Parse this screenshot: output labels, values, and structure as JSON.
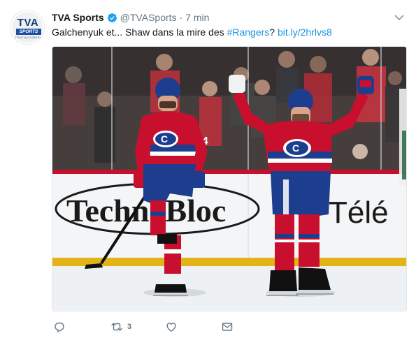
{
  "author": {
    "display_name": "TVA Sports",
    "handle": "@TVASports",
    "separator": "·",
    "timestamp": "7 min",
    "verified": true,
    "avatar": {
      "logo_text": "TVA",
      "logo_band": "SPORTS",
      "logo_sub": "TOUT AU COEUR"
    }
  },
  "tweet": {
    "text_before": "Galchenyuk et... Shaw dans la mire des ",
    "hashtag": "#Rangers",
    "text_middle": "? ",
    "link": "bit.ly/2hrlvs8"
  },
  "media": {
    "board_text_left": "TechnoBloc",
    "board_text_right": "Télé",
    "player_left_number": "24",
    "colors": {
      "jersey_red": "#c8102e",
      "jersey_blue": "#1d3e8f",
      "ice": "#eef1f3",
      "crowd": "#3a3030"
    }
  },
  "actions": {
    "reply_icon": "reply-icon",
    "retweet_icon": "retweet-icon",
    "retweet_count": "3",
    "like_icon": "heart-icon",
    "dm_icon": "envelope-icon"
  },
  "colors": {
    "link": "#1b95e0",
    "secondary_text": "#657786",
    "verified": "#1da1f2"
  }
}
